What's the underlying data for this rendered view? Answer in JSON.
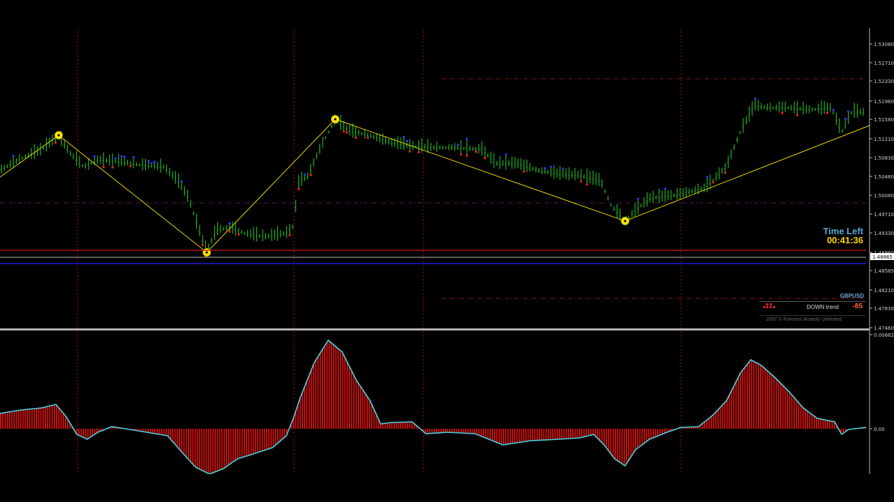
{
  "price_axis": {
    "labels": [
      "1.53080",
      "1.52710",
      "1.52330",
      "1.51960",
      "1.51580",
      "1.51210",
      "1.50830",
      "1.50460",
      "1.50080",
      "1.49710",
      "1.49330",
      "1.48960",
      "1.48585",
      "1.48210",
      "1.47830",
      "1.47460"
    ],
    "current_price_tag": "1.48865"
  },
  "indicator_axis": {
    "top_label": "0.00662",
    "zero_label": "0.00"
  },
  "time_left": {
    "title": "Time Left",
    "value": "00:41:36"
  },
  "trend_panel": {
    "symbol": "GBPUSD",
    "trend_label": "DOWN trend",
    "trend_value": "-85",
    "copyright": "2007 © Forexinn Anatoly Unlimited"
  },
  "colors": {
    "candle": "#22b022",
    "zigzag": "#e6d600",
    "histogram": "#e01010",
    "signal_line": "#4ad6e6",
    "level_red": "#c81e1e",
    "level_blue": "#1b1bd8",
    "separator": "#b4b4b4"
  },
  "icons": [
    "zigzag-pivot-icon",
    "trend-dots-icon"
  ]
}
